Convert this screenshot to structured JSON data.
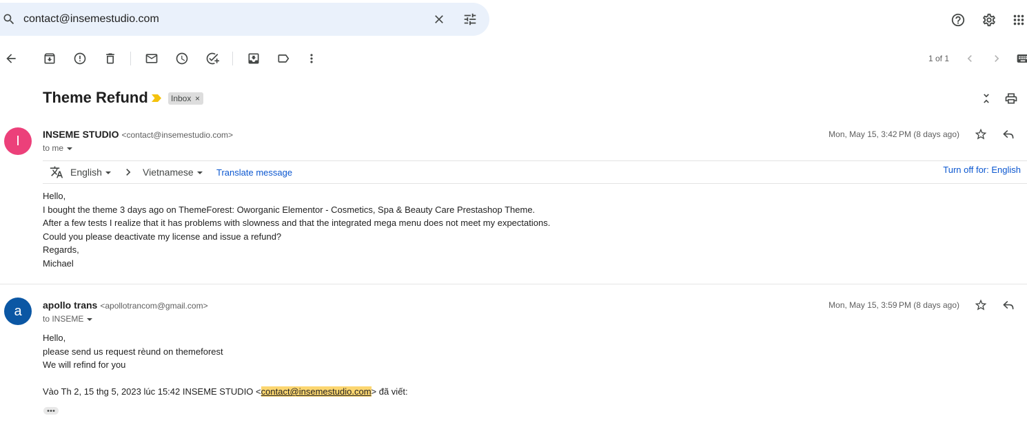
{
  "search": {
    "query": "contact@insemestudio.com",
    "icons": {
      "search": "search-icon",
      "clear": "close-icon",
      "options": "tune-icon"
    }
  },
  "header": {
    "icons": {
      "support": "help-icon",
      "settings": "settings-icon",
      "apps": "apps-grid-icon"
    }
  },
  "toolbar": {
    "icons": [
      "back-arrow-icon",
      "archive-icon",
      "report-spam-icon",
      "delete-icon",
      "mark-unread-icon",
      "snooze-icon",
      "add-task-icon",
      "move-to-icon",
      "label-icon",
      "more-vert-icon"
    ],
    "pagination": "1 of 1",
    "nav_icons": [
      "chevron-left-icon",
      "chevron-right-icon",
      "keyboard-icon"
    ]
  },
  "thread": {
    "subject": "Theme Refund",
    "label": "Inbox",
    "label_remove": "×",
    "icons": [
      "important-marker-icon",
      "unfold-less-icon",
      "print-icon"
    ]
  },
  "translate_bar": {
    "source_language": "English",
    "target_language": "Vietnamese",
    "translate_link": "Translate message",
    "turn_off": "Turn off for: English"
  },
  "messages": [
    {
      "avatar_letter": "I",
      "avatar_color": "#ec407a",
      "sender_name": "INSEME STUDIO",
      "sender_email": "<contact@insemestudio.com>",
      "recipient": "to me",
      "date": "Mon, May 15, 3:42 PM (8 days ago)",
      "body": [
        "Hello,",
        "I bought the theme 3 days ago on ThemeForest: Oworganic Elementor - Cosmetics, Spa & Beauty Care Prestashop Theme.",
        "After a few tests I realize that it has problems with slowness and that the integrated mega menu does not meet my expectations.",
        "Could you please deactivate my license and issue a refund?",
        "Regards,",
        "Michael"
      ]
    },
    {
      "avatar_letter": "a",
      "avatar_color": "#0b57a4",
      "sender_name": "apollo trans",
      "sender_email": "<apollotrancom@gmail.com>",
      "recipient": "to INSEME",
      "date": "Mon, May 15, 3:59 PM (8 days ago)",
      "body": [
        "Hello,",
        "please send us request rèund on themeforest",
        "We will refind for you"
      ],
      "quote": {
        "prefix": "Vào Th 2, 15 thg 5, 2023 lúc 15:42 INSEME STUDIO <",
        "email": "contact@insemestudio.com",
        "suffix": "> đã viết:"
      }
    }
  ],
  "colors": {
    "search_bg": "#eaf1fb",
    "icon": "#444746",
    "link": "#0b57d0",
    "important_marker": "#f4c20d",
    "email_highlight": "#fcd670"
  }
}
